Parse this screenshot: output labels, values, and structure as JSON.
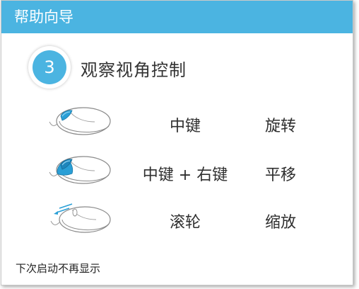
{
  "window": {
    "title": "帮助向导"
  },
  "step": {
    "number": "3",
    "title": "观察视角控制"
  },
  "controls": [
    {
      "action": "中键",
      "effect": "旋转",
      "mouse_icon": "mouse-middle-button-icon"
    },
    {
      "action": "中键 + 右键",
      "effect": "平移",
      "mouse_icon": "mouse-middle-right-button-icon"
    },
    {
      "action": "滚轮",
      "effect": "缩放",
      "mouse_icon": "mouse-scroll-wheel-icon"
    }
  ],
  "footer": {
    "dont_show_again": "下次启动不再显示"
  },
  "colors": {
    "accent": "#4bb4e1",
    "highlight": "#2a9fd6"
  }
}
